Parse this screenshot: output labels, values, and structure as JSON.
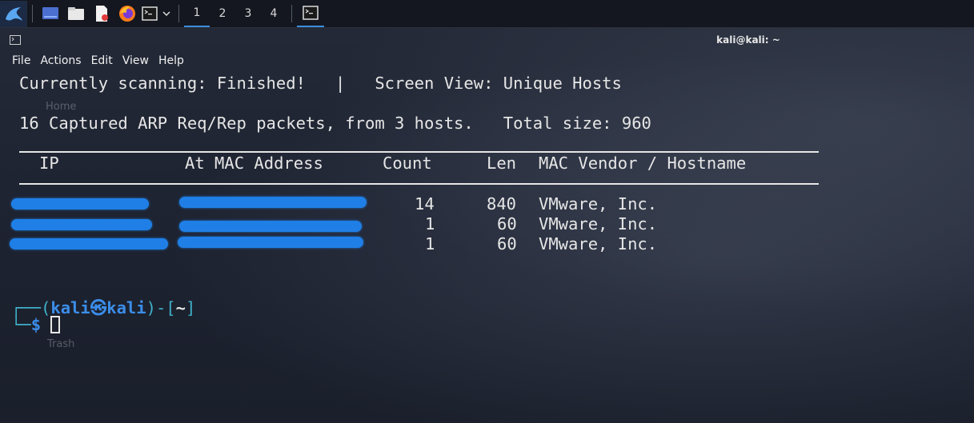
{
  "panel": {
    "workspaces": [
      "1",
      "2",
      "3",
      "4"
    ]
  },
  "window": {
    "title": "kali@kali: ~"
  },
  "menu": [
    "File",
    "Actions",
    "Edit",
    "View",
    "Help"
  ],
  "desktop": {
    "home_label": "Home",
    "trash_label": "Trash"
  },
  "netdiscover": {
    "status_line": "Currently scanning: Finished!   |   Screen View: Unique Hosts",
    "summary_line": "16 Captured ARP Req/Rep packets, from 3 hosts.   Total size: 960",
    "headers": {
      "ip": "IP",
      "mac": "At MAC Address",
      "count": "Count",
      "len": "Len",
      "vendor": "MAC Vendor / Hostname"
    },
    "rows": [
      {
        "count": "14",
        "len": "840",
        "vendor": "VMware, Inc."
      },
      {
        "count": "1",
        "len": "60",
        "vendor": "VMware, Inc."
      },
      {
        "count": "1",
        "len": "60",
        "vendor": "VMware, Inc."
      }
    ]
  },
  "prompt": {
    "open": "┌──(",
    "user": "kali",
    "at": "㉿",
    "host": "kali",
    "close": ")-[",
    "dir": "~",
    "end": "]",
    "corner": "└─",
    "dollar": "$"
  }
}
